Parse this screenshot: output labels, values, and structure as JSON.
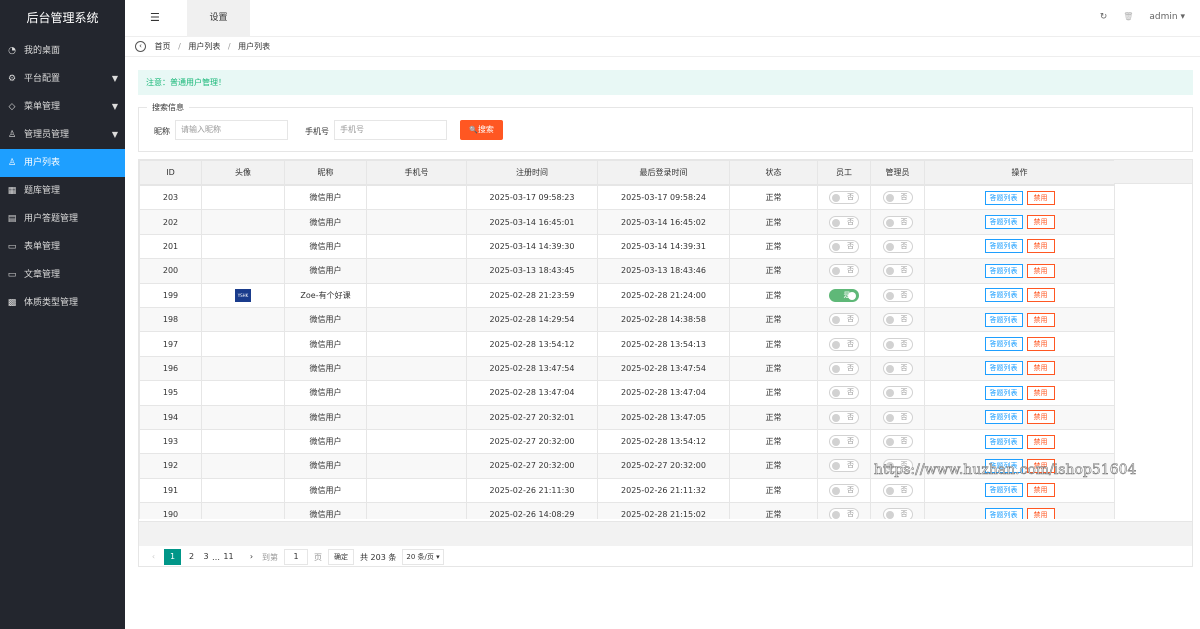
{
  "app": {
    "title": "后台管理系统"
  },
  "sidebar": {
    "items": [
      {
        "label": "我的桌面",
        "icon": "dashboard-icon",
        "glyph": "◔",
        "arrow": false,
        "active": false
      },
      {
        "label": "平台配置",
        "icon": "gear-icon",
        "glyph": "⚙",
        "arrow": true,
        "active": false
      },
      {
        "label": "菜单管理",
        "icon": "tag-icon",
        "glyph": "◇",
        "arrow": true,
        "active": false
      },
      {
        "label": "管理员管理",
        "icon": "user-icon",
        "glyph": "♙",
        "arrow": true,
        "active": false
      },
      {
        "label": "用户列表",
        "icon": "users-icon",
        "glyph": "♙",
        "arrow": false,
        "active": true
      },
      {
        "label": "题库管理",
        "icon": "grid-icon",
        "glyph": "▦",
        "arrow": false,
        "active": false
      },
      {
        "label": "用户答题管理",
        "icon": "print-icon",
        "glyph": "▤",
        "arrow": false,
        "active": false
      },
      {
        "label": "表单管理",
        "icon": "form-icon",
        "glyph": "▭",
        "arrow": false,
        "active": false
      },
      {
        "label": "文章管理",
        "icon": "article-icon",
        "glyph": "▭",
        "arrow": false,
        "active": false
      },
      {
        "label": "体质类型管理",
        "icon": "type-icon",
        "glyph": "▩",
        "arrow": false,
        "active": false
      }
    ]
  },
  "topbar": {
    "menu_icon": "☰",
    "tab": "设置",
    "refresh": "↻",
    "trash": "🗑",
    "user": "admin ▾"
  },
  "breadcrumb": {
    "back": "‹",
    "items": [
      "首页",
      "用户列表",
      "用户列表"
    ],
    "sep": "/"
  },
  "notice": "注意：普通用户管理！",
  "search": {
    "legend": "搜索信息",
    "nick_label": "昵称",
    "nick_placeholder": "请输入昵称",
    "phone_label": "手机号",
    "phone_placeholder": "手机号",
    "button": "搜索",
    "button_icon": "🔍"
  },
  "table": {
    "columns": [
      "ID",
      "头像",
      "昵称",
      "手机号",
      "注册时间",
      "最后登录时间",
      "状态",
      "员工",
      "管理员",
      "操作"
    ],
    "rows": [
      {
        "id": "203",
        "avatar": "",
        "nick": "微信用户",
        "phone": "",
        "reg": "2025-03-17 09:58:23",
        "last": "2025-03-17 09:58:24",
        "status": "正常",
        "staff": false,
        "admin": false
      },
      {
        "id": "202",
        "avatar": "",
        "nick": "微信用户",
        "phone": "",
        "reg": "2025-03-14 16:45:01",
        "last": "2025-03-14 16:45:02",
        "status": "正常",
        "staff": false,
        "admin": false
      },
      {
        "id": "201",
        "avatar": "",
        "nick": "微信用户",
        "phone": "",
        "reg": "2025-03-14 14:39:30",
        "last": "2025-03-14 14:39:31",
        "status": "正常",
        "staff": false,
        "admin": false
      },
      {
        "id": "200",
        "avatar": "",
        "nick": "微信用户",
        "phone": "",
        "reg": "2025-03-13 18:43:45",
        "last": "2025-03-13 18:43:46",
        "status": "正常",
        "staff": false,
        "admin": false
      },
      {
        "id": "199",
        "avatar": "YSHK",
        "nick": "Zoe-有个好课",
        "phone": "",
        "reg": "2025-02-28 21:23:59",
        "last": "2025-02-28 21:24:00",
        "status": "正常",
        "staff": true,
        "admin": false
      },
      {
        "id": "198",
        "avatar": "",
        "nick": "微信用户",
        "phone": "",
        "reg": "2025-02-28 14:29:54",
        "last": "2025-02-28 14:38:58",
        "status": "正常",
        "staff": false,
        "admin": false
      },
      {
        "id": "197",
        "avatar": "",
        "nick": "微信用户",
        "phone": "",
        "reg": "2025-02-28 13:54:12",
        "last": "2025-02-28 13:54:13",
        "status": "正常",
        "staff": false,
        "admin": false
      },
      {
        "id": "196",
        "avatar": "",
        "nick": "微信用户",
        "phone": "",
        "reg": "2025-02-28 13:47:54",
        "last": "2025-02-28 13:47:54",
        "status": "正常",
        "staff": false,
        "admin": false
      },
      {
        "id": "195",
        "avatar": "",
        "nick": "微信用户",
        "phone": "",
        "reg": "2025-02-28 13:47:04",
        "last": "2025-02-28 13:47:04",
        "status": "正常",
        "staff": false,
        "admin": false
      },
      {
        "id": "194",
        "avatar": "",
        "nick": "微信用户",
        "phone": "",
        "reg": "2025-02-27 20:32:01",
        "last": "2025-02-28 13:47:05",
        "status": "正常",
        "staff": false,
        "admin": false
      },
      {
        "id": "193",
        "avatar": "",
        "nick": "微信用户",
        "phone": "",
        "reg": "2025-02-27 20:32:00",
        "last": "2025-02-28 13:54:12",
        "status": "正常",
        "staff": false,
        "admin": false
      },
      {
        "id": "192",
        "avatar": "",
        "nick": "微信用户",
        "phone": "",
        "reg": "2025-02-27 20:32:00",
        "last": "2025-02-27 20:32:00",
        "status": "正常",
        "staff": false,
        "admin": false
      },
      {
        "id": "191",
        "avatar": "",
        "nick": "微信用户",
        "phone": "",
        "reg": "2025-02-26 21:11:30",
        "last": "2025-02-26 21:11:32",
        "status": "正常",
        "staff": false,
        "admin": false
      },
      {
        "id": "190",
        "avatar": "",
        "nick": "微信用户",
        "phone": "",
        "reg": "2025-02-26 14:08:29",
        "last": "2025-02-28 21:15:02",
        "status": "正常",
        "staff": false,
        "admin": false
      }
    ],
    "switch_on": "是",
    "switch_off": "否",
    "action_list": "答题列表",
    "action_ban": "禁用"
  },
  "pager": {
    "prev": "‹",
    "pages": [
      "1",
      "2",
      "3"
    ],
    "ellipsis": "…",
    "last": "11",
    "next": "›",
    "goto_label": "到第",
    "goto_value": "1",
    "page_unit": "页",
    "confirm": "确定",
    "total": "共 203 条",
    "page_size": "20 条/页 ▾"
  },
  "watermark": "https://www.huzhan.com/ishop51604"
}
